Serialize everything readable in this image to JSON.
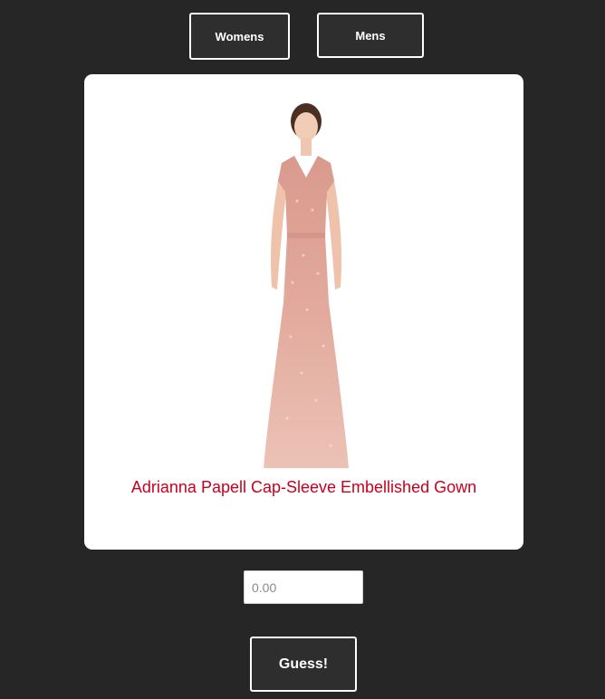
{
  "nav": {
    "womens_label": "Womens",
    "mens_label": "Mens"
  },
  "product": {
    "title": "Adrianna Papell Cap-Sleeve Embellished Gown",
    "image_alt": "woman-in-pink-embellished-gown-photo",
    "title_color": "#c8001e"
  },
  "guess": {
    "price_placeholder": "0.00",
    "button_label": "Guess!"
  }
}
